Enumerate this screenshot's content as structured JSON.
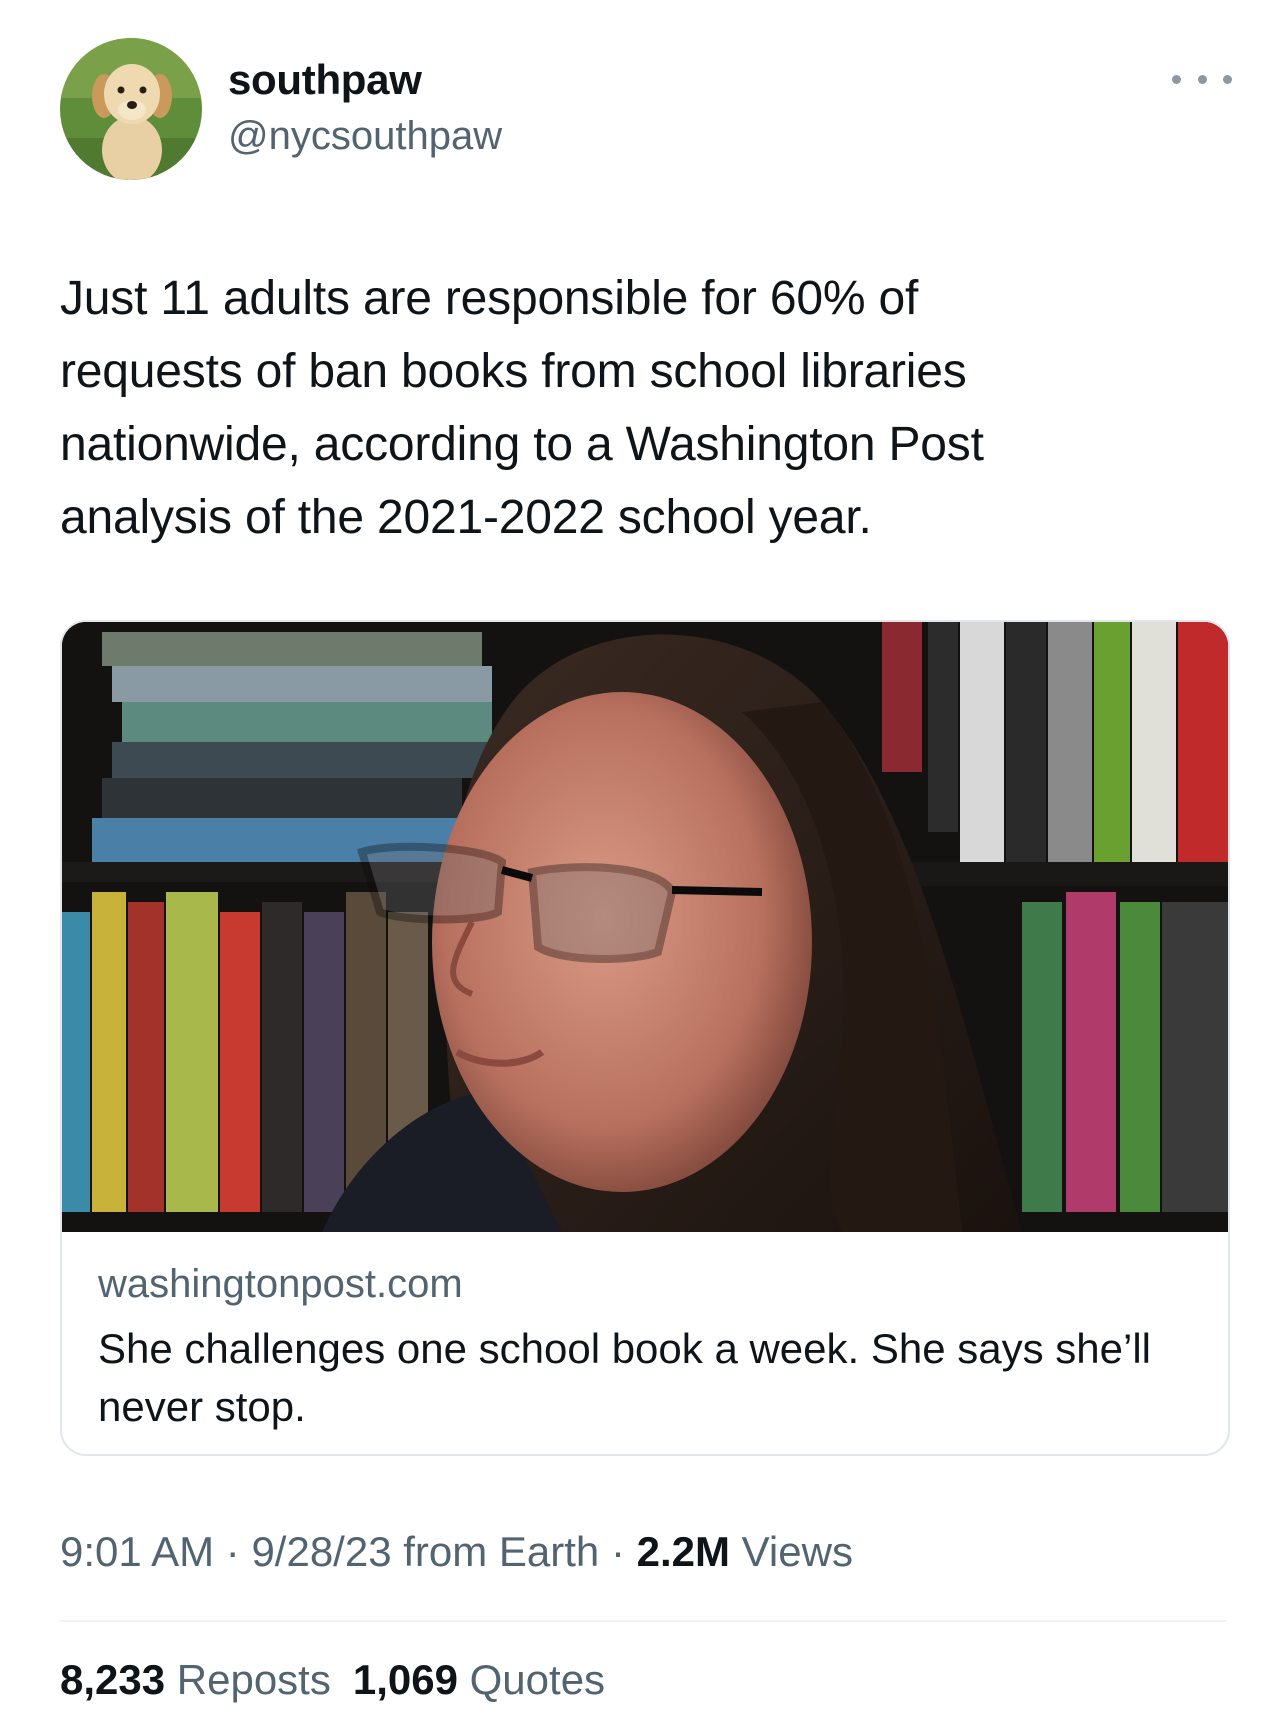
{
  "author": {
    "display_name": "southpaw",
    "handle": "@nycsouthpaw",
    "avatar_icon": "golden-retriever-puppy-avatar"
  },
  "more_icon": "more-options-icon",
  "tweet": {
    "text": "Just 11 adults are responsible for 60% of\nrequests of ban books from school libraries\nnationwide, according to a Washington Post\nanalysis of the 2021-2022 school year."
  },
  "card": {
    "domain": "washingtonpost.com",
    "title": "She challenges one school book a week. She says she’ll never stop."
  },
  "meta": {
    "time": "9:01 AM",
    "sep1": " · ",
    "date_source": "9/28/23 from Earth",
    "sep2": " · ",
    "views_count": "2.2M",
    "views_label": " Views"
  },
  "stats": {
    "reposts_count": "8,233",
    "reposts_label": " Reposts",
    "quotes_count": "1,069",
    "quotes_label": " Quotes"
  },
  "colors": {
    "text_primary": "#0f1419",
    "text_secondary": "#536471",
    "border": "#e1e6ea"
  }
}
